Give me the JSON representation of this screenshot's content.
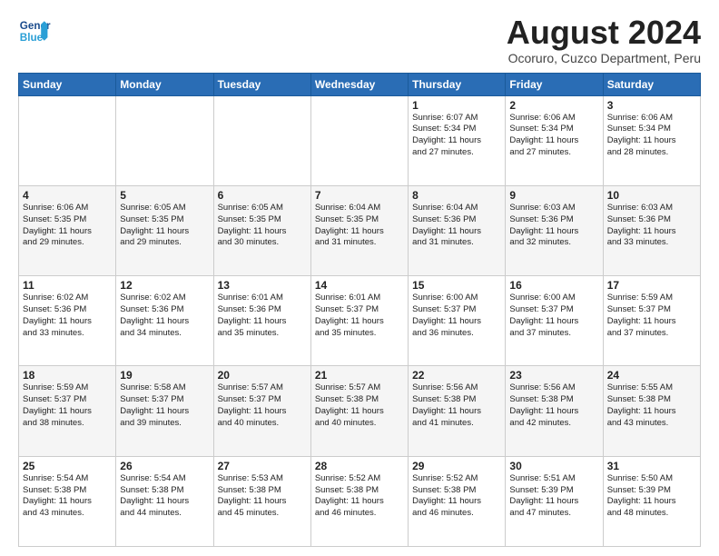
{
  "header": {
    "logo_text_general": "General",
    "logo_text_blue": "Blue",
    "month_title": "August 2024",
    "location": "Ocoruro, Cuzco Department, Peru"
  },
  "days_of_week": [
    "Sunday",
    "Monday",
    "Tuesday",
    "Wednesday",
    "Thursday",
    "Friday",
    "Saturday"
  ],
  "weeks": [
    [
      {
        "day": "",
        "info": ""
      },
      {
        "day": "",
        "info": ""
      },
      {
        "day": "",
        "info": ""
      },
      {
        "day": "",
        "info": ""
      },
      {
        "day": "1",
        "info": "Sunrise: 6:07 AM\nSunset: 5:34 PM\nDaylight: 11 hours\nand 27 minutes."
      },
      {
        "day": "2",
        "info": "Sunrise: 6:06 AM\nSunset: 5:34 PM\nDaylight: 11 hours\nand 27 minutes."
      },
      {
        "day": "3",
        "info": "Sunrise: 6:06 AM\nSunset: 5:34 PM\nDaylight: 11 hours\nand 28 minutes."
      }
    ],
    [
      {
        "day": "4",
        "info": "Sunrise: 6:06 AM\nSunset: 5:35 PM\nDaylight: 11 hours\nand 29 minutes."
      },
      {
        "day": "5",
        "info": "Sunrise: 6:05 AM\nSunset: 5:35 PM\nDaylight: 11 hours\nand 29 minutes."
      },
      {
        "day": "6",
        "info": "Sunrise: 6:05 AM\nSunset: 5:35 PM\nDaylight: 11 hours\nand 30 minutes."
      },
      {
        "day": "7",
        "info": "Sunrise: 6:04 AM\nSunset: 5:35 PM\nDaylight: 11 hours\nand 31 minutes."
      },
      {
        "day": "8",
        "info": "Sunrise: 6:04 AM\nSunset: 5:36 PM\nDaylight: 11 hours\nand 31 minutes."
      },
      {
        "day": "9",
        "info": "Sunrise: 6:03 AM\nSunset: 5:36 PM\nDaylight: 11 hours\nand 32 minutes."
      },
      {
        "day": "10",
        "info": "Sunrise: 6:03 AM\nSunset: 5:36 PM\nDaylight: 11 hours\nand 33 minutes."
      }
    ],
    [
      {
        "day": "11",
        "info": "Sunrise: 6:02 AM\nSunset: 5:36 PM\nDaylight: 11 hours\nand 33 minutes."
      },
      {
        "day": "12",
        "info": "Sunrise: 6:02 AM\nSunset: 5:36 PM\nDaylight: 11 hours\nand 34 minutes."
      },
      {
        "day": "13",
        "info": "Sunrise: 6:01 AM\nSunset: 5:36 PM\nDaylight: 11 hours\nand 35 minutes."
      },
      {
        "day": "14",
        "info": "Sunrise: 6:01 AM\nSunset: 5:37 PM\nDaylight: 11 hours\nand 35 minutes."
      },
      {
        "day": "15",
        "info": "Sunrise: 6:00 AM\nSunset: 5:37 PM\nDaylight: 11 hours\nand 36 minutes."
      },
      {
        "day": "16",
        "info": "Sunrise: 6:00 AM\nSunset: 5:37 PM\nDaylight: 11 hours\nand 37 minutes."
      },
      {
        "day": "17",
        "info": "Sunrise: 5:59 AM\nSunset: 5:37 PM\nDaylight: 11 hours\nand 37 minutes."
      }
    ],
    [
      {
        "day": "18",
        "info": "Sunrise: 5:59 AM\nSunset: 5:37 PM\nDaylight: 11 hours\nand 38 minutes."
      },
      {
        "day": "19",
        "info": "Sunrise: 5:58 AM\nSunset: 5:37 PM\nDaylight: 11 hours\nand 39 minutes."
      },
      {
        "day": "20",
        "info": "Sunrise: 5:57 AM\nSunset: 5:37 PM\nDaylight: 11 hours\nand 40 minutes."
      },
      {
        "day": "21",
        "info": "Sunrise: 5:57 AM\nSunset: 5:38 PM\nDaylight: 11 hours\nand 40 minutes."
      },
      {
        "day": "22",
        "info": "Sunrise: 5:56 AM\nSunset: 5:38 PM\nDaylight: 11 hours\nand 41 minutes."
      },
      {
        "day": "23",
        "info": "Sunrise: 5:56 AM\nSunset: 5:38 PM\nDaylight: 11 hours\nand 42 minutes."
      },
      {
        "day": "24",
        "info": "Sunrise: 5:55 AM\nSunset: 5:38 PM\nDaylight: 11 hours\nand 43 minutes."
      }
    ],
    [
      {
        "day": "25",
        "info": "Sunrise: 5:54 AM\nSunset: 5:38 PM\nDaylight: 11 hours\nand 43 minutes."
      },
      {
        "day": "26",
        "info": "Sunrise: 5:54 AM\nSunset: 5:38 PM\nDaylight: 11 hours\nand 44 minutes."
      },
      {
        "day": "27",
        "info": "Sunrise: 5:53 AM\nSunset: 5:38 PM\nDaylight: 11 hours\nand 45 minutes."
      },
      {
        "day": "28",
        "info": "Sunrise: 5:52 AM\nSunset: 5:38 PM\nDaylight: 11 hours\nand 46 minutes."
      },
      {
        "day": "29",
        "info": "Sunrise: 5:52 AM\nSunset: 5:38 PM\nDaylight: 11 hours\nand 46 minutes."
      },
      {
        "day": "30",
        "info": "Sunrise: 5:51 AM\nSunset: 5:39 PM\nDaylight: 11 hours\nand 47 minutes."
      },
      {
        "day": "31",
        "info": "Sunrise: 5:50 AM\nSunset: 5:39 PM\nDaylight: 11 hours\nand 48 minutes."
      }
    ]
  ]
}
